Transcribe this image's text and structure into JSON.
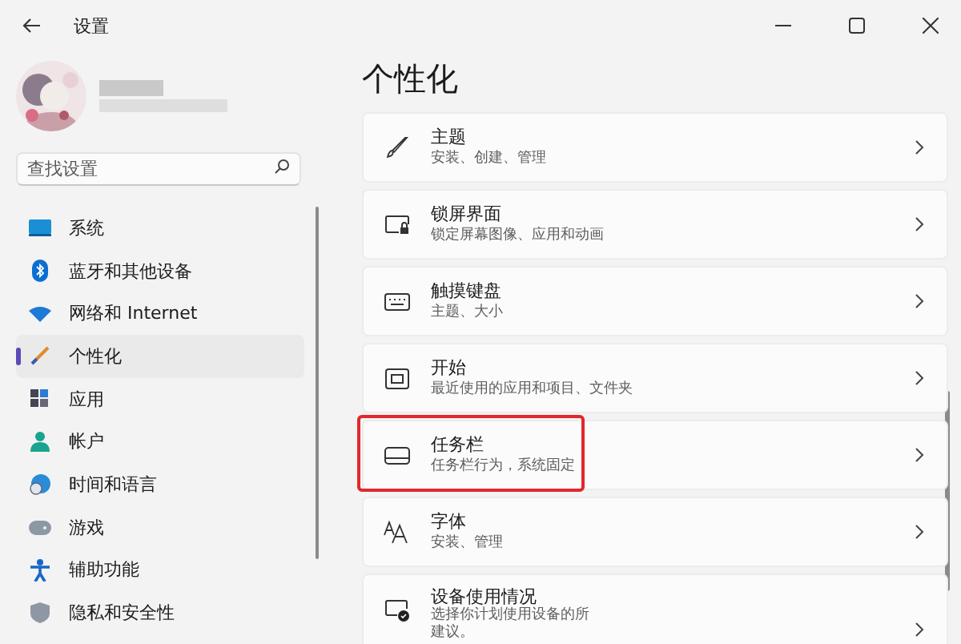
{
  "window": {
    "title": "设置"
  },
  "search": {
    "placeholder": "查找设置"
  },
  "nav": [
    {
      "label": "系统",
      "selected": false
    },
    {
      "label": "蓝牙和其他设备",
      "selected": false
    },
    {
      "label": "网络和 Internet",
      "selected": false
    },
    {
      "label": "个性化",
      "selected": true
    },
    {
      "label": "应用",
      "selected": false
    },
    {
      "label": "帐户",
      "selected": false
    },
    {
      "label": "时间和语言",
      "selected": false
    },
    {
      "label": "游戏",
      "selected": false
    },
    {
      "label": "辅助功能",
      "selected": false
    },
    {
      "label": "隐私和安全性",
      "selected": false
    }
  ],
  "page_title": "个性化",
  "cards": [
    {
      "title": "主题",
      "description_lines": [
        "安装、创建、管理"
      ],
      "highlighted": false
    },
    {
      "title": "锁屏界面",
      "description_lines": [
        "锁定屏幕图像、应用和动画"
      ],
      "highlighted": false
    },
    {
      "title": "触摸键盘",
      "description_lines": [
        "主题、大小"
      ],
      "highlighted": false
    },
    {
      "title": "开始",
      "description_lines": [
        "最近使用的应用和项目、文件夹"
      ],
      "highlighted": false
    },
    {
      "title": "任务栏",
      "description_lines": [
        "任务栏行为，系统固定"
      ],
      "highlighted": true
    },
    {
      "title": "字体",
      "description_lines": [
        "安装、管理"
      ],
      "highlighted": false
    },
    {
      "title": "设备使用情况",
      "description_lines": [
        "选择你计划使用设备的所",
        "建议。"
      ],
      "highlighted": false
    }
  ]
}
